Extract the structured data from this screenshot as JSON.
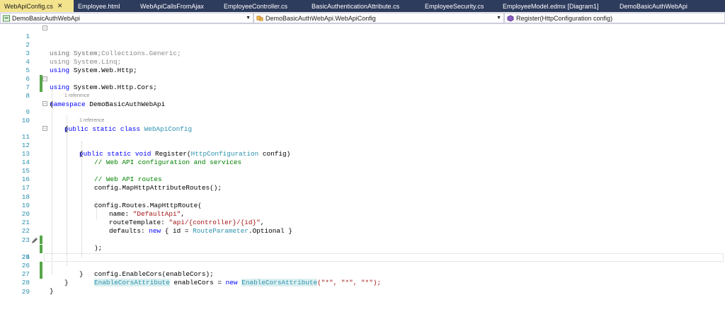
{
  "tabs": [
    {
      "label": "WebApiConfig.cs",
      "active": true,
      "close": "✕"
    },
    {
      "label": "Employee.html"
    },
    {
      "label": "WebApiCallsFromAjax"
    },
    {
      "label": "EmployeeController.cs"
    },
    {
      "label": "BasicAuthenticationAttribute.cs"
    },
    {
      "label": "EmployeeSecurity.cs"
    },
    {
      "label": "EmployeeModel.edmx [Diagram1]"
    },
    {
      "label": "DemoBasicAuthWebApi"
    }
  ],
  "navbar": {
    "project": "DemoBasicAuthWebApi",
    "type": "DemoBasicAuthWebApi.WebApiConfig",
    "member": "Register(HttpConfiguration config)"
  },
  "editor": {
    "line_numbers": [
      "1",
      "2",
      "3",
      "4",
      "5",
      "6",
      "7",
      "8",
      "9",
      "10",
      "11",
      "12",
      "13",
      "14",
      "15",
      "16",
      "17",
      "18",
      "19",
      "20",
      "21",
      "22",
      "23",
      "24",
      "25",
      "26",
      "27",
      "28",
      "29"
    ],
    "codelens": [
      "1 reference",
      "1 reference"
    ],
    "tokens": {
      "using": "using",
      "system": " System;",
      "system_generic": " System.Collections.Generic;",
      "system_linq": " System.Linq;",
      "system_web_http": " System.Web.Http;",
      "system_web_http_cors": " System.Web.Http.Cors;",
      "namespace": "namespace",
      "namespace_name": " DemoBasicAuthWebApi",
      "open_brace": "{",
      "close_brace": "}",
      "public": "public",
      "static": "static",
      "class": "class",
      "void": "void",
      "new": "new",
      "class_name": "WebApiConfig",
      "register": " Register(",
      "http_config": "HttpConfiguration",
      "config_param": " config)",
      "comment_config": "// Web API configuration and services",
      "comment_routes": "// Web API routes",
      "map_attr_routes": "config.MapHttpAttributeRoutes();",
      "map_route": "config.Routes.MapHttpRoute(",
      "name_key": "name: ",
      "name_val": "\"DefaultApi\"",
      "template_key": "routeTemplate: ",
      "template_val": "\"api/{controller}/{id}\"",
      "comma": ",",
      "defaults_key": "defaults: ",
      "defaults_mid": " { id = ",
      "route_parameter": "RouteParameter",
      "optional": ".Optional }",
      "close_call": ");",
      "cors_attr": "EnableCorsAttribute",
      "enable_cors_var": " enableCors = ",
      "cors_args": "(\"*\", \"*\", \"*\");",
      "enable_cors_call": "config.EnableCors(enableCors);"
    }
  },
  "colors": {
    "tab_bar": "#2d3b5c",
    "active_tab": "#f3e38d",
    "keyword": "#0000ff",
    "type": "#2b91af",
    "comment": "#008000",
    "string": "#a31515",
    "change_marker": "#57a64a"
  },
  "icons": [
    "close-icon",
    "csharp-project-icon",
    "class-icon",
    "method-icon",
    "dropdown-arrow-icon",
    "collapse-icon",
    "pencil-icon"
  ]
}
